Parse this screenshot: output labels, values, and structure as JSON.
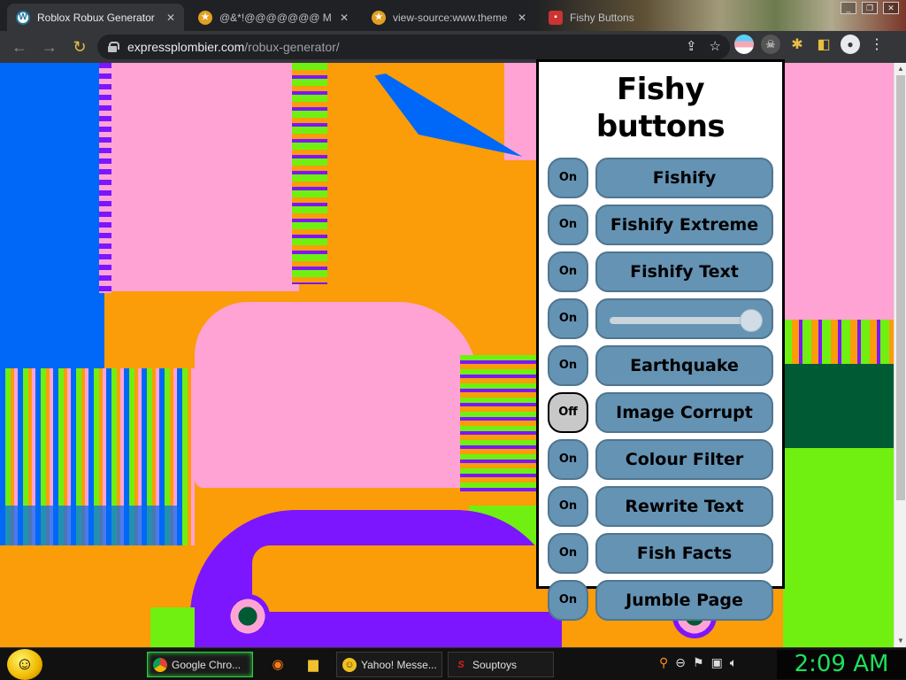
{
  "browser": {
    "tabs": [
      {
        "title": "Roblox Robux Generator",
        "icon": "wordpress-icon",
        "active": true
      },
      {
        "title": "@&*!@@@@@@@ M",
        "icon": "stars-icon",
        "active": false
      },
      {
        "title": "view-source:www.theme",
        "icon": "stars-icon",
        "active": false
      },
      {
        "title": "Fishy Buttons",
        "icon": "fish-icon",
        "active": false
      }
    ],
    "url_host": "expressplombier.com",
    "url_path": "/robux-generator/"
  },
  "panel": {
    "title": "Fishy buttons",
    "rows": [
      {
        "toggle": "On",
        "label": "Fishify"
      },
      {
        "toggle": "On",
        "label": "Fishify Extreme"
      },
      {
        "toggle": "On",
        "label": "Fishify Text"
      },
      {
        "toggle": "On",
        "label": "",
        "slider_value": 1.0
      },
      {
        "toggle": "On",
        "label": "Earthquake"
      },
      {
        "toggle": "Off",
        "label": "Image Corrupt"
      },
      {
        "toggle": "On",
        "label": "Colour Filter"
      },
      {
        "toggle": "On",
        "label": "Rewrite Text"
      },
      {
        "toggle": "On",
        "label": "Fish Facts"
      },
      {
        "toggle": "On",
        "label": "Jumble Page"
      }
    ]
  },
  "taskbar": {
    "items": [
      {
        "label": "Google Chro...",
        "icon": "chrome-icon",
        "active": true
      },
      {
        "label": "Yahoo! Messe...",
        "icon": "yahoo-messenger-icon",
        "active": false
      },
      {
        "label": "Souptoys",
        "icon": "souptoys-icon",
        "active": false
      }
    ],
    "clock": "2:09 AM"
  },
  "colors": {
    "button_blue": "#6593b4",
    "toggle_off": "#c8c8c8",
    "clock_green": "#1ee05a"
  }
}
